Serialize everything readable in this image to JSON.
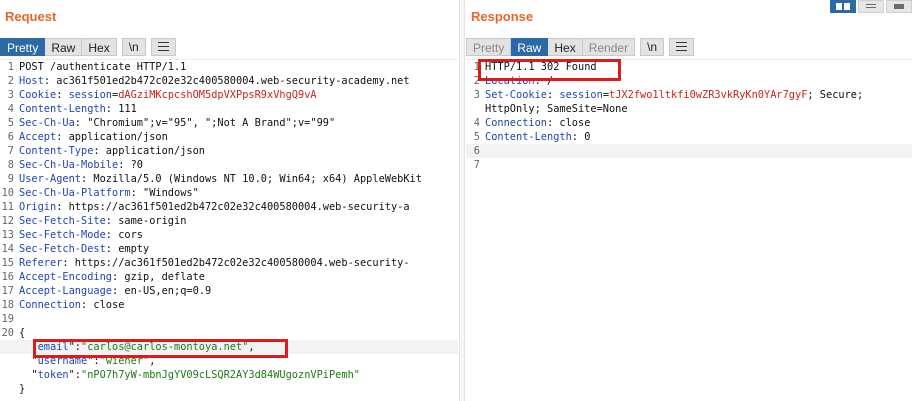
{
  "request": {
    "title": "Request",
    "tabs": [
      {
        "label": "Pretty",
        "active": true
      },
      {
        "label": "Raw",
        "active": false
      },
      {
        "label": "Hex",
        "active": false
      }
    ],
    "newline_btn": "\\n",
    "menu_icon": "hamburger-menu-icon",
    "lines": [
      {
        "n": "1",
        "parts": [
          {
            "t": "POST /authenticate HTTP/1.1",
            "c": "v"
          }
        ]
      },
      {
        "n": "2",
        "parts": [
          {
            "t": "Host",
            "c": "k"
          },
          {
            "t": ": ac361f501ed2b472c02e32c400580004.web-security-academy.net",
            "c": "v"
          }
        ]
      },
      {
        "n": "3",
        "parts": [
          {
            "t": "Cookie",
            "c": "k"
          },
          {
            "t": ": ",
            "c": "v"
          },
          {
            "t": "session",
            "c": "k"
          },
          {
            "t": "=",
            "c": "v"
          },
          {
            "t": "dAGziMKcpcshOM5dpVXPpsR9xVhgQ9vA",
            "c": "r"
          }
        ]
      },
      {
        "n": "4",
        "parts": [
          {
            "t": "Content-Length",
            "c": "k"
          },
          {
            "t": ": 111",
            "c": "v"
          }
        ]
      },
      {
        "n": "5",
        "parts": [
          {
            "t": "Sec-Ch-Ua",
            "c": "k"
          },
          {
            "t": ": \"Chromium\";v=\"95\", \";Not A Brand\";v=\"99\"",
            "c": "v"
          }
        ]
      },
      {
        "n": "6",
        "parts": [
          {
            "t": "Accept",
            "c": "k"
          },
          {
            "t": ": application/json",
            "c": "v"
          }
        ]
      },
      {
        "n": "7",
        "parts": [
          {
            "t": "Content-Type",
            "c": "k"
          },
          {
            "t": ": application/json",
            "c": "v"
          }
        ]
      },
      {
        "n": "8",
        "parts": [
          {
            "t": "Sec-Ch-Ua-Mobile",
            "c": "k"
          },
          {
            "t": ": ?0",
            "c": "v"
          }
        ]
      },
      {
        "n": "9",
        "parts": [
          {
            "t": "User-Agent",
            "c": "k"
          },
          {
            "t": ": Mozilla/5.0 (Windows NT 10.0; Win64; x64) AppleWebKit",
            "c": "v"
          }
        ]
      },
      {
        "n": "10",
        "parts": [
          {
            "t": "Sec-Ch-Ua-Platform",
            "c": "k"
          },
          {
            "t": ": \"Windows\"",
            "c": "v"
          }
        ]
      },
      {
        "n": "11",
        "parts": [
          {
            "t": "Origin",
            "c": "k"
          },
          {
            "t": ": https://ac361f501ed2b472c02e32c400580004.web-security-a",
            "c": "v"
          }
        ]
      },
      {
        "n": "12",
        "parts": [
          {
            "t": "Sec-Fetch-Site",
            "c": "k"
          },
          {
            "t": ": same-origin",
            "c": "v"
          }
        ]
      },
      {
        "n": "13",
        "parts": [
          {
            "t": "Sec-Fetch-Mode",
            "c": "k"
          },
          {
            "t": ": cors",
            "c": "v"
          }
        ]
      },
      {
        "n": "14",
        "parts": [
          {
            "t": "Sec-Fetch-Dest",
            "c": "k"
          },
          {
            "t": ": empty",
            "c": "v"
          }
        ]
      },
      {
        "n": "15",
        "parts": [
          {
            "t": "Referer",
            "c": "k"
          },
          {
            "t": ": https://ac361f501ed2b472c02e32c400580004.web-security-",
            "c": "v"
          }
        ]
      },
      {
        "n": "16",
        "parts": [
          {
            "t": "Accept-Encoding",
            "c": "k"
          },
          {
            "t": ": gzip, deflate",
            "c": "v"
          }
        ]
      },
      {
        "n": "17",
        "parts": [
          {
            "t": "Accept-Language",
            "c": "k"
          },
          {
            "t": ": en-US,en;q=0.9",
            "c": "v"
          }
        ]
      },
      {
        "n": "18",
        "parts": [
          {
            "t": "Connection",
            "c": "k"
          },
          {
            "t": ": close",
            "c": "v"
          }
        ]
      },
      {
        "n": "19",
        "parts": []
      },
      {
        "n": "20",
        "parts": [
          {
            "t": "{",
            "c": "v"
          }
        ]
      },
      {
        "n": "",
        "parts": [
          {
            "t": "  \"",
            "c": "v"
          },
          {
            "t": "email",
            "c": "k"
          },
          {
            "t": "\":",
            "c": "v"
          },
          {
            "t": "\"carlos@carlos-montoya.net\"",
            "c": "g"
          },
          {
            "t": ",",
            "c": "v"
          }
        ],
        "hl": true
      },
      {
        "n": "",
        "parts": [
          {
            "t": "  \"",
            "c": "v"
          },
          {
            "t": "username",
            "c": "k"
          },
          {
            "t": "\":",
            "c": "v"
          },
          {
            "t": "\"wiener\"",
            "c": "g"
          },
          {
            "t": ",",
            "c": "v"
          }
        ]
      },
      {
        "n": "",
        "parts": [
          {
            "t": "  \"",
            "c": "v"
          },
          {
            "t": "token",
            "c": "k"
          },
          {
            "t": "\":",
            "c": "v"
          },
          {
            "t": "\"nPO7h7yW-mbnJgYV09cLSQR2AY3d84WUgoznVPiPemh\"",
            "c": "g"
          }
        ]
      },
      {
        "n": "",
        "parts": [
          {
            "t": "}",
            "c": "v"
          }
        ]
      }
    ]
  },
  "response": {
    "title": "Response",
    "tabs": [
      {
        "label": "Pretty",
        "active": false,
        "disabled": true
      },
      {
        "label": "Raw",
        "active": true
      },
      {
        "label": "Hex",
        "active": false
      },
      {
        "label": "Render",
        "active": false,
        "disabled": true
      }
    ],
    "newline_btn": "\\n",
    "menu_icon": "hamburger-menu-icon",
    "lines": [
      {
        "n": "1",
        "parts": [
          {
            "t": "HTTP/1.1 302 Found",
            "c": "v"
          }
        ]
      },
      {
        "n": "2",
        "parts": [
          {
            "t": "Location",
            "c": "k"
          },
          {
            "t": ": /",
            "c": "v"
          }
        ]
      },
      {
        "n": "3",
        "parts": [
          {
            "t": "Set-Cookie",
            "c": "k"
          },
          {
            "t": ": ",
            "c": "v"
          },
          {
            "t": "session",
            "c": "k"
          },
          {
            "t": "=",
            "c": "v"
          },
          {
            "t": "tJX2fwo1ltkfi0wZR3vkRyKn0YAr7gyF",
            "c": "r"
          },
          {
            "t": "; Secure;",
            "c": "v"
          }
        ]
      },
      {
        "n": "",
        "parts": [
          {
            "t": "HttpOnly; SameSite=None",
            "c": "v"
          }
        ]
      },
      {
        "n": "4",
        "parts": [
          {
            "t": "Connection",
            "c": "k"
          },
          {
            "t": ": close",
            "c": "v"
          }
        ]
      },
      {
        "n": "5",
        "parts": [
          {
            "t": "Content-Length",
            "c": "k"
          },
          {
            "t": ": 0",
            "c": "v"
          }
        ]
      },
      {
        "n": "6",
        "parts": [],
        "hl": true
      },
      {
        "n": "7",
        "parts": []
      }
    ]
  },
  "layout_buttons": [
    "split-horizontal-icon",
    "split-vertical-icon",
    "single-pane-icon"
  ]
}
